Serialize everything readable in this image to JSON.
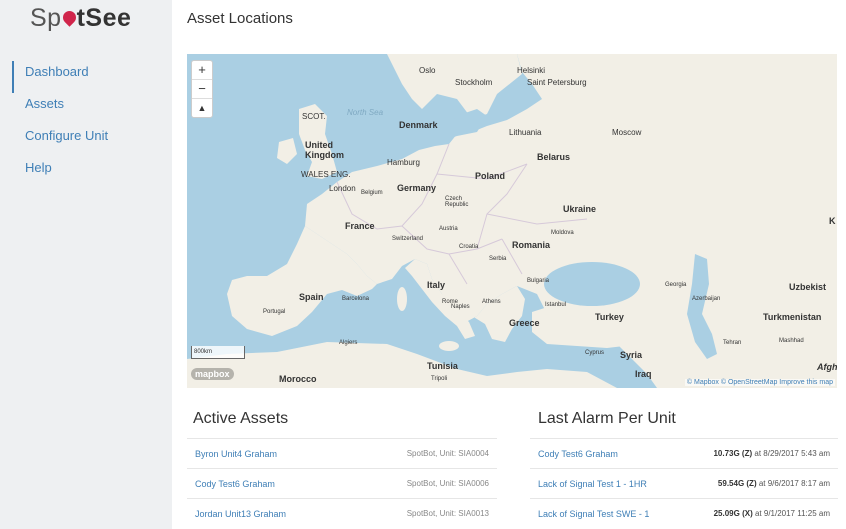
{
  "app": {
    "logo_part1": "Sp",
    "logo_part2": "t",
    "logo_part3": "See"
  },
  "sidebar": {
    "items": [
      {
        "label": "Dashboard",
        "active": true
      },
      {
        "label": "Assets"
      },
      {
        "label": "Configure Unit"
      },
      {
        "label": "Help"
      }
    ]
  },
  "page": {
    "title": "Asset Locations"
  },
  "map": {
    "zoom_in": "+",
    "zoom_out": "−",
    "compass": "▲",
    "scale": "800km",
    "logo": "mapbox",
    "attribution": "© Mapbox © OpenStreetMap Improve this map",
    "labels": {
      "oslo": "Oslo",
      "stockholm": "Stockholm",
      "helsinki": "Helsinki",
      "saint_petersburg": "Saint Petersburg",
      "scot": "SCOT.",
      "north_sea": "North Sea",
      "denmark": "Denmark",
      "lithuania": "Lithuania",
      "moscow": "Moscow",
      "united_kingdom": "United Kingdom",
      "wales": "WALES ENG.",
      "london": "London",
      "hamburg": "Hamburg",
      "belarus": "Belarus",
      "poland": "Poland",
      "germany": "Germany",
      "belgium": "Belgium",
      "czech": "Czech Republic",
      "ukraine": "Ukraine",
      "france": "France",
      "switzerland": "Switzerland",
      "austria": "Austria",
      "moldova": "Moldova",
      "croatia": "Croatia",
      "romania": "Romania",
      "serbia": "Serbia",
      "bulgaria": "Bulgaria",
      "italy": "Italy",
      "spain": "Spain",
      "portugal": "Portugal",
      "barcelona": "Barcelona",
      "rome": "Rome",
      "naples": "Naples",
      "athens": "Athens",
      "istanbul": "Istanbul",
      "georgia": "Georgia",
      "azerbaijan": "Azerbaijan",
      "uzbekistan": "Uzbekist",
      "greece": "Greece",
      "turkey": "Turkey",
      "turkmenistan": "Turkmenistan",
      "tehran": "Tehran",
      "mashhad": "Mashhad",
      "algiers": "Algiers",
      "tunisia": "Tunisia",
      "cyprus": "Cyprus",
      "syria": "Syria",
      "iraq": "Iraq",
      "morocco": "Morocco",
      "tripoli": "Tripoli",
      "afghanistan": "Afgh",
      "k": "K"
    }
  },
  "active_assets": {
    "title": "Active Assets",
    "rows": [
      {
        "name": "Byron Unit4 Graham",
        "meta": "SpotBot, Unit: SIA0004"
      },
      {
        "name": "Cody Test6 Graham",
        "meta": "SpotBot, Unit: SIA0006"
      },
      {
        "name": "Jordan Unit13 Graham",
        "meta": "SpotBot, Unit: SIA0013"
      }
    ]
  },
  "last_alarm": {
    "title": "Last Alarm Per Unit",
    "rows": [
      {
        "name": "Cody Test6 Graham",
        "value": "10.73G (Z)",
        "rest": " at 8/29/2017 5:43 am"
      },
      {
        "name": "Lack of Signal Test 1 - 1HR",
        "value": "59.54G (Z)",
        "rest": " at 9/6/2017 8:17 am"
      },
      {
        "name": "Lack of Signal Test SWE - 1",
        "value": "25.09G (X)",
        "rest": " at 9/1/2017 11:25 am"
      }
    ]
  },
  "colors": {
    "land": "#f2efe6",
    "water": "#aacfe3",
    "link": "#3f7fb6",
    "pin": "#d0254b"
  }
}
